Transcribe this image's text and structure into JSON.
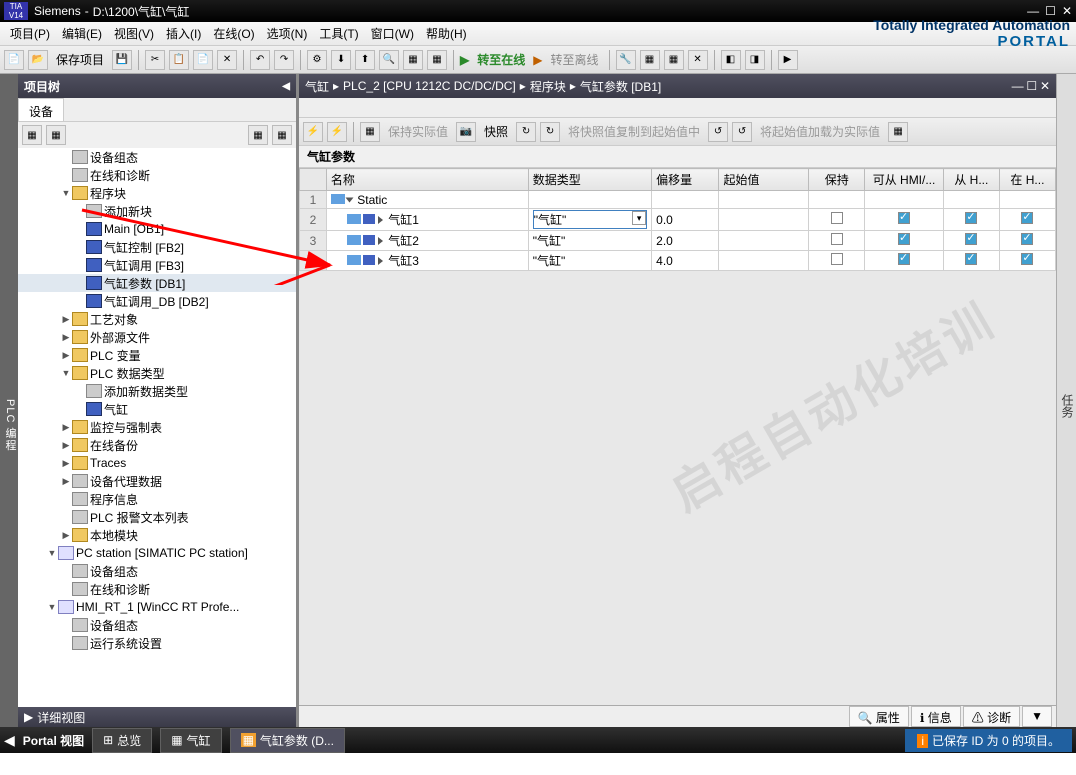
{
  "title": {
    "app": "Siemens",
    "path": "D:\\1200\\气缸\\气缸"
  },
  "tia": {
    "line1": "Totally Integrated Automation",
    "line2": "PORTAL"
  },
  "menu": {
    "project": "项目(P)",
    "edit": "编辑(E)",
    "view": "视图(V)",
    "insert": "插入(I)",
    "online": "在线(O)",
    "options": "选项(N)",
    "tools": "工具(T)",
    "window": "窗口(W)",
    "help": "帮助(H)"
  },
  "toolbar": {
    "save": "保存项目",
    "goonline": "转至在线",
    "gooffline": "转至离线"
  },
  "vtab": "PLC 编程",
  "tree": {
    "title": "项目树",
    "tab": "设备",
    "items": [
      {
        "lvl": 3,
        "icon": "gray",
        "label": "设备组态"
      },
      {
        "lvl": 3,
        "icon": "gray",
        "label": "在线和诊断"
      },
      {
        "lvl": 3,
        "exp": "▼",
        "icon": "folder",
        "label": "程序块"
      },
      {
        "lvl": 4,
        "icon": "gray",
        "label": "添加新块"
      },
      {
        "lvl": 4,
        "icon": "block",
        "label": "Main [OB1]"
      },
      {
        "lvl": 4,
        "icon": "block",
        "label": "气缸控制 [FB2]"
      },
      {
        "lvl": 4,
        "icon": "block",
        "label": "气缸调用 [FB3]"
      },
      {
        "lvl": 4,
        "icon": "block",
        "label": "气缸参数 [DB1]",
        "sel": true
      },
      {
        "lvl": 4,
        "icon": "block",
        "label": "气缸调用_DB [DB2]"
      },
      {
        "lvl": 3,
        "exp": "▶",
        "icon": "folder",
        "label": "工艺对象"
      },
      {
        "lvl": 3,
        "exp": "▶",
        "icon": "folder",
        "label": "外部源文件"
      },
      {
        "lvl": 3,
        "exp": "▶",
        "icon": "folder",
        "label": "PLC 变量"
      },
      {
        "lvl": 3,
        "exp": "▼",
        "icon": "folder",
        "label": "PLC 数据类型"
      },
      {
        "lvl": 4,
        "icon": "gray",
        "label": "添加新数据类型"
      },
      {
        "lvl": 4,
        "icon": "block",
        "label": "气缸"
      },
      {
        "lvl": 3,
        "exp": "▶",
        "icon": "folder",
        "label": "监控与强制表"
      },
      {
        "lvl": 3,
        "exp": "▶",
        "icon": "folder",
        "label": "在线备份"
      },
      {
        "lvl": 3,
        "exp": "▶",
        "icon": "folder",
        "label": "Traces"
      },
      {
        "lvl": 3,
        "exp": "▶",
        "icon": "gray",
        "label": "设备代理数据"
      },
      {
        "lvl": 3,
        "icon": "gray",
        "label": "程序信息"
      },
      {
        "lvl": 3,
        "icon": "gray",
        "label": "PLC 报警文本列表"
      },
      {
        "lvl": 3,
        "exp": "▶",
        "icon": "folder",
        "label": "本地模块"
      },
      {
        "lvl": 2,
        "exp": "▼",
        "icon": "pc",
        "label": "PC station [SIMATIC PC station]"
      },
      {
        "lvl": 3,
        "icon": "gray",
        "label": "设备组态"
      },
      {
        "lvl": 3,
        "icon": "gray",
        "label": "在线和诊断"
      },
      {
        "lvl": 2,
        "exp": "▼",
        "icon": "pc",
        "label": "HMI_RT_1 [WinCC RT Profe..."
      },
      {
        "lvl": 3,
        "icon": "gray",
        "label": "设备组态"
      },
      {
        "lvl": 3,
        "icon": "gray",
        "label": "运行系统设置"
      }
    ],
    "detail": "详细视图"
  },
  "sidetask": "任务",
  "editor": {
    "bc": {
      "p1": "气缸",
      "p2": "PLC_2 [CPU 1212C DC/DC/DC]",
      "p3": "程序块",
      "p4": "气缸参数 [DB1]"
    },
    "rtb": {
      "b1": "保持实际值",
      "b2": "快照",
      "b3": "将快照值复制到起始值中",
      "b4": "将起始值加载为实际值"
    },
    "dbtitle": "气缸参数",
    "cols": {
      "name": "名称",
      "dtype": "数据类型",
      "offset": "偏移量",
      "start": "起始值",
      "retain": "保持",
      "hmi": "可从 HMI/...",
      "hmi2": "从 H...",
      "hmi3": "在 H..."
    },
    "rows": [
      {
        "n": "1",
        "lvl": 0,
        "exp": "open",
        "name": "Static",
        "dtype": "",
        "offset": "",
        "start": ""
      },
      {
        "n": "2",
        "lvl": 1,
        "exp": "closed",
        "name": "气缸1",
        "dtype": "\"气缸\"",
        "offset": "0.0",
        "start": "",
        "edit": true
      },
      {
        "n": "3",
        "lvl": 1,
        "exp": "closed",
        "name": "气缸2",
        "dtype": "\"气缸\"",
        "offset": "2.0",
        "start": ""
      },
      {
        "n": "",
        "lvl": 1,
        "exp": "closed",
        "name": "气缸3",
        "dtype": "\"气缸\"",
        "offset": "4.0",
        "start": ""
      }
    ]
  },
  "props": {
    "prop": "属性",
    "info": "信息",
    "diag": "诊断"
  },
  "bottom": {
    "portal": "Portal 视图",
    "overview": "总览",
    "qg": "气缸",
    "qgparam": "气缸参数 (D...",
    "status": "已保存 ID 为 0 的项目。"
  },
  "watermark": "启程自动化培训"
}
